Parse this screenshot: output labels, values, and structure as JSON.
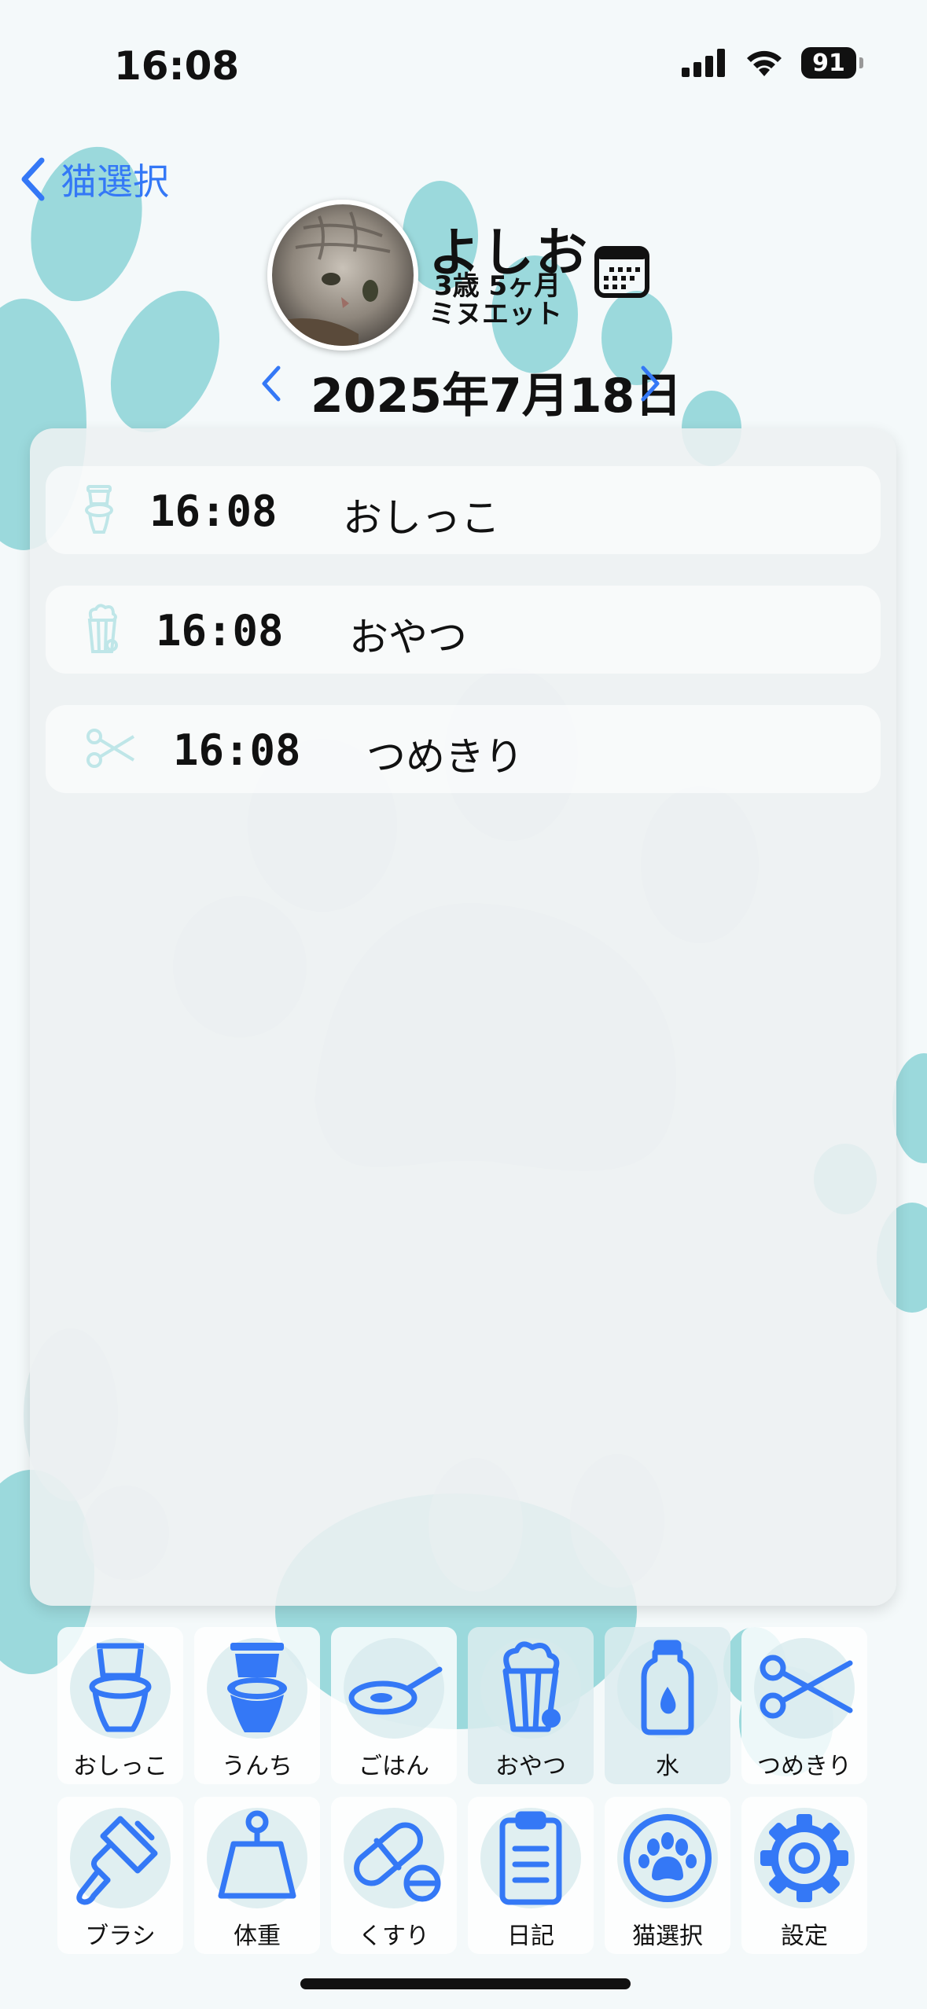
{
  "status_bar": {
    "time": "16:08",
    "battery": "91"
  },
  "nav": {
    "back_label": "猫選択"
  },
  "cat": {
    "name": "よしお",
    "age": "3歳 5ヶ月",
    "breed": "ミヌエット"
  },
  "date": "2025年7月18日",
  "entries": [
    {
      "time": "16:08",
      "label": "おしっこ",
      "icon": "toilet-icon"
    },
    {
      "time": "16:08",
      "label": "おやつ",
      "icon": "popcorn-icon"
    },
    {
      "time": "16:08",
      "label": "つめきり",
      "icon": "scissors-icon"
    }
  ],
  "buttons": [
    {
      "label": "おしっこ",
      "icon": "toilet-icon"
    },
    {
      "label": "うんち",
      "icon": "toilet-filled-icon"
    },
    {
      "label": "ごはん",
      "icon": "frying-pan-icon"
    },
    {
      "label": "おやつ",
      "icon": "popcorn-icon"
    },
    {
      "label": "水",
      "icon": "water-bottle-icon"
    },
    {
      "label": "つめきり",
      "icon": "scissors-icon"
    },
    {
      "label": "ブラシ",
      "icon": "brush-icon"
    },
    {
      "label": "体重",
      "icon": "scale-weight-icon"
    },
    {
      "label": "くすり",
      "icon": "pills-icon"
    },
    {
      "label": "日記",
      "icon": "clipboard-icon"
    },
    {
      "label": "猫選択",
      "icon": "paw-circle-icon"
    },
    {
      "label": "設定",
      "icon": "gear-icon"
    }
  ],
  "colors": {
    "accent": "#3478f6",
    "paw": "#8fd3d6",
    "icon_light": "#bfe6e8"
  }
}
